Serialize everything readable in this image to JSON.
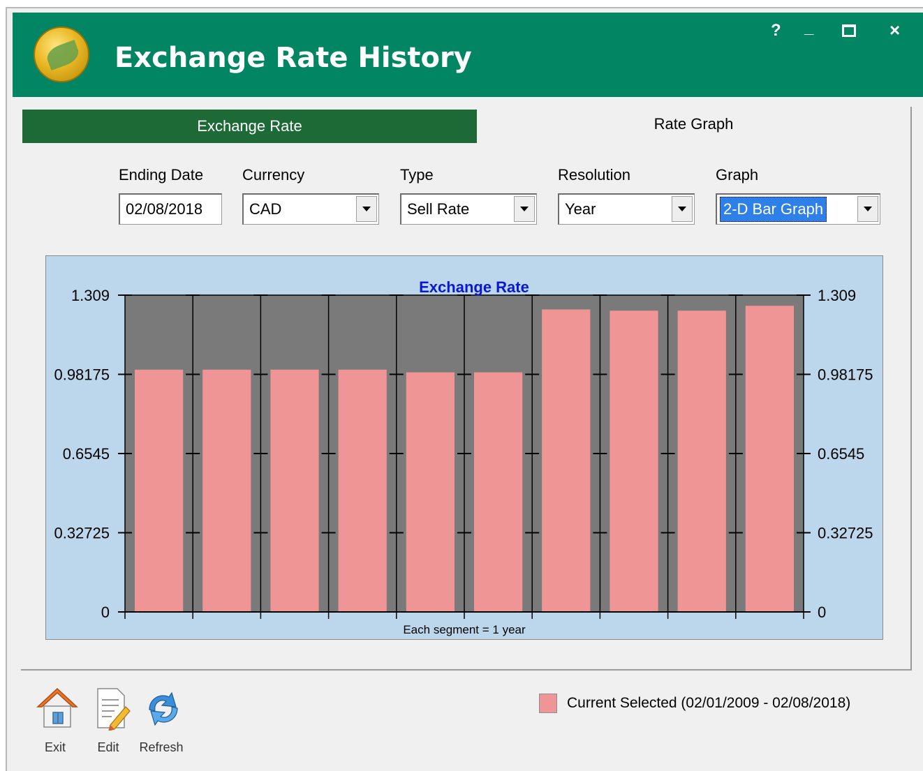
{
  "window": {
    "title": "Exchange Rate History",
    "help_label": "?",
    "minimize_label": "_",
    "close_label": "×"
  },
  "tabs": [
    {
      "label": "Exchange Rate",
      "active": true
    },
    {
      "label": "Rate Graph",
      "active": false
    }
  ],
  "filters": {
    "ending_date": {
      "label": "Ending Date",
      "value": "02/08/2018"
    },
    "currency": {
      "label": "Currency",
      "value": "CAD"
    },
    "type": {
      "label": "Type",
      "value": "Sell Rate"
    },
    "resolution": {
      "label": "Resolution",
      "value": "Year"
    },
    "graph": {
      "label": "Graph",
      "value": "2-D Bar Graph"
    }
  },
  "chart_data": {
    "type": "bar",
    "title": "Exchange Rate",
    "xlabel": "Each segment = 1 year",
    "ylabel": "",
    "categories": [
      "",
      "",
      "",
      "",
      "",
      "",
      "",
      "",
      "",
      ""
    ],
    "series": [
      {
        "name": "Current Selected (02/01/2009 - 02/08/2018)",
        "values": [
          1.001,
          1.001,
          1.001,
          1.001,
          0.99,
          0.99,
          1.25,
          1.245,
          1.245,
          1.265
        ]
      }
    ],
    "ylim": [
      0,
      1.309
    ],
    "yticks": [
      "0",
      "0.32725",
      "0.6545",
      "0.98175",
      "1.309"
    ],
    "grid": true,
    "dual_y_axis": true,
    "colors": {
      "bar": "#ef9595",
      "plot_bg": "#7a7a7a",
      "chart_bg": "#bcd7ec",
      "title": "#0b17d8"
    }
  },
  "toolbar": {
    "exit_label": "Exit",
    "edit_label": "Edit",
    "refresh_label": "Refresh"
  },
  "legend": {
    "label": "Current Selected (02/01/2009 - 02/08/2018)"
  },
  "colors": {
    "titlebar": "#018562",
    "active_tab": "#1d6a36"
  }
}
